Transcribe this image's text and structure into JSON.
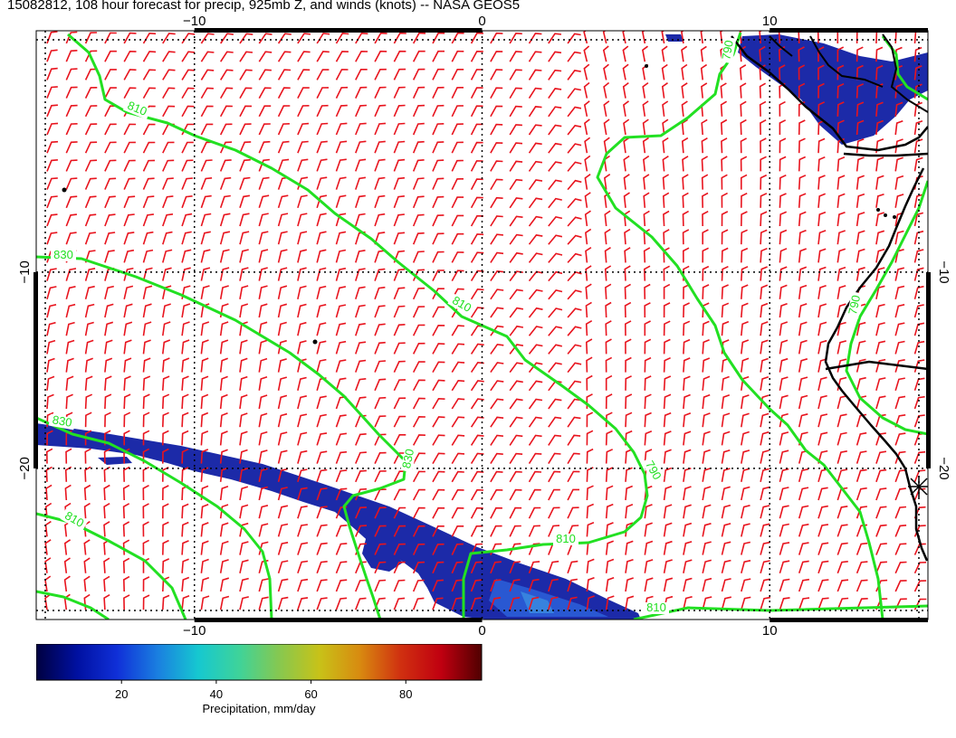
{
  "title": "15082812, 108 hour forecast for precip, 925mb Z, and winds (knots) -- NASA GEOS5",
  "map": {
    "lon_range": [
      -15.5,
      15.5
    ],
    "lat_range": [
      -27.7,
      2.3
    ],
    "lon_ticks": [
      {
        "value": -10,
        "label": "−10"
      },
      {
        "value": 0,
        "label": "0"
      },
      {
        "value": 10,
        "label": "10"
      }
    ],
    "lat_ticks": [
      {
        "value": -10,
        "label": "−10"
      },
      {
        "value": -20,
        "label": "−20"
      }
    ],
    "contour_labels": [
      "810",
      "830",
      "810",
      "790",
      "830",
      "830",
      "810",
      "810",
      "790",
      "790",
      "810"
    ],
    "colors": {
      "wind_barbs": "#e8141e",
      "height_contours": "#22e022",
      "precip": "#1c2aa8",
      "coastline": "#000000"
    }
  },
  "colorbar": {
    "range": [
      2,
      96
    ],
    "ticks": [
      {
        "value": 20,
        "label": "20"
      },
      {
        "value": 40,
        "label": "40"
      },
      {
        "value": 60,
        "label": "60"
      },
      {
        "value": 80,
        "label": "80"
      }
    ],
    "title": "Precipitation, mm/day",
    "colors": [
      "#000040",
      "#0010a0",
      "#1030d8",
      "#1a7fe0",
      "#16c8d0",
      "#3ed39a",
      "#86c850",
      "#c8c218",
      "#d88a10",
      "#d03010",
      "#c00010",
      "#500000"
    ]
  }
}
